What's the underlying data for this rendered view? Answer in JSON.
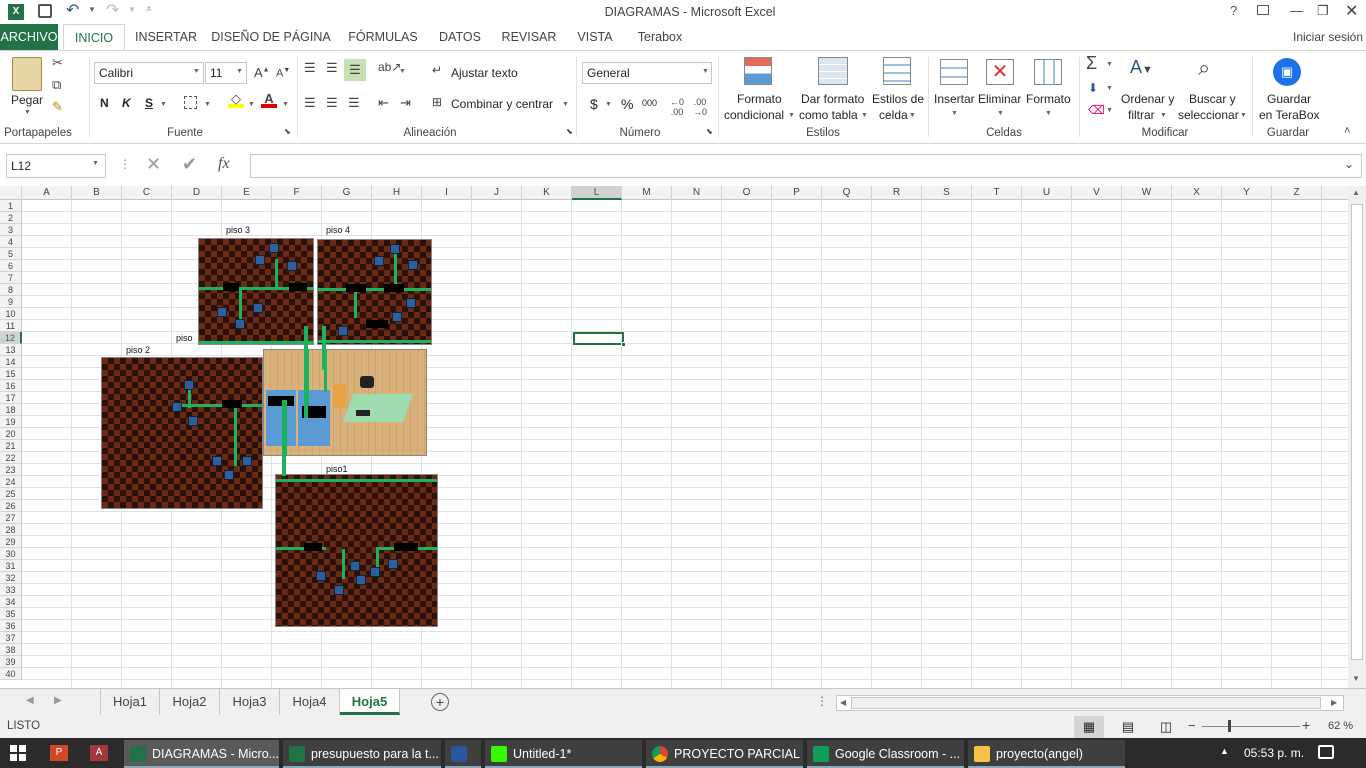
{
  "window": {
    "title": "DIAGRAMAS - Microsoft Excel",
    "help": "?",
    "sign_in": "Iniciar sesión"
  },
  "ribbon_tabs": [
    "ARCHIVO",
    "INICIO",
    "INSERTAR",
    "DISEÑO DE PÁGINA",
    "FÓRMULAS",
    "DATOS",
    "REVISAR",
    "VISTA",
    "Terabox"
  ],
  "ribbon": {
    "paste": "Pegar",
    "font_name": "Calibri",
    "font_size": "11",
    "bold": "N",
    "italic": "K",
    "underline": "S",
    "wrap_text": "Ajustar texto",
    "merge_center": "Combinar y centrar",
    "number_format": "General",
    "currency": "$",
    "percent": "%",
    "thousands": "000",
    "cond_format": [
      "Formato",
      "condicional"
    ],
    "format_table": [
      "Dar formato",
      "como tabla"
    ],
    "cell_styles": [
      "Estilos de",
      "celda"
    ],
    "insert": "Insertar",
    "delete": "Eliminar",
    "format": "Formato",
    "sort_filter": [
      "Ordenar y",
      "filtrar"
    ],
    "find_select": [
      "Buscar y",
      "seleccionar"
    ],
    "save_terabox": [
      "Guardar",
      "en TeraBox"
    ],
    "groups": {
      "clipboard": "Portapapeles",
      "font": "Fuente",
      "alignment": "Alineación",
      "number": "Número",
      "styles": "Estilos",
      "cells": "Celdas",
      "modify": "Modificar",
      "save": "Guardar"
    }
  },
  "formula_bar": {
    "name_box": "L12",
    "fx": "fx",
    "formula": ""
  },
  "columns": [
    "A",
    "B",
    "C",
    "D",
    "E",
    "F",
    "G",
    "H",
    "I",
    "J",
    "K",
    "L",
    "M",
    "N",
    "O",
    "P",
    "Q",
    "R",
    "S",
    "T",
    "U",
    "V",
    "W",
    "X",
    "Y",
    "Z"
  ],
  "rows": [
    "1",
    "2",
    "3",
    "4",
    "5",
    "6",
    "7",
    "8",
    "9",
    "10",
    "11",
    "12",
    "13",
    "14",
    "15",
    "16",
    "17",
    "18",
    "19",
    "20",
    "21",
    "22",
    "23",
    "24",
    "25",
    "26",
    "27",
    "28",
    "29",
    "30",
    "31",
    "32",
    "33",
    "34",
    "35",
    "36",
    "37",
    "38",
    "39",
    "40"
  ],
  "selected_cell": "L12",
  "images": {
    "piso3": "piso 3",
    "piso4": "piso 4",
    "piso2": "piso 2",
    "piso_entry": "piso",
    "piso1": "piso1"
  },
  "sheet_tabs": [
    "Hoja1",
    "Hoja2",
    "Hoja3",
    "Hoja4",
    "Hoja5"
  ],
  "active_sheet": "Hoja5",
  "status": {
    "mode": "LISTO",
    "zoom": "62 %"
  },
  "taskbar": {
    "items": [
      "DIAGRAMAS - Micro...",
      "presupuesto para la t...",
      "",
      "Untitled-1*",
      "PROYECTO PARCIAL ...",
      "Google Classroom - ...",
      "proyecto(angel)"
    ],
    "clock": "05:53 p. m."
  }
}
